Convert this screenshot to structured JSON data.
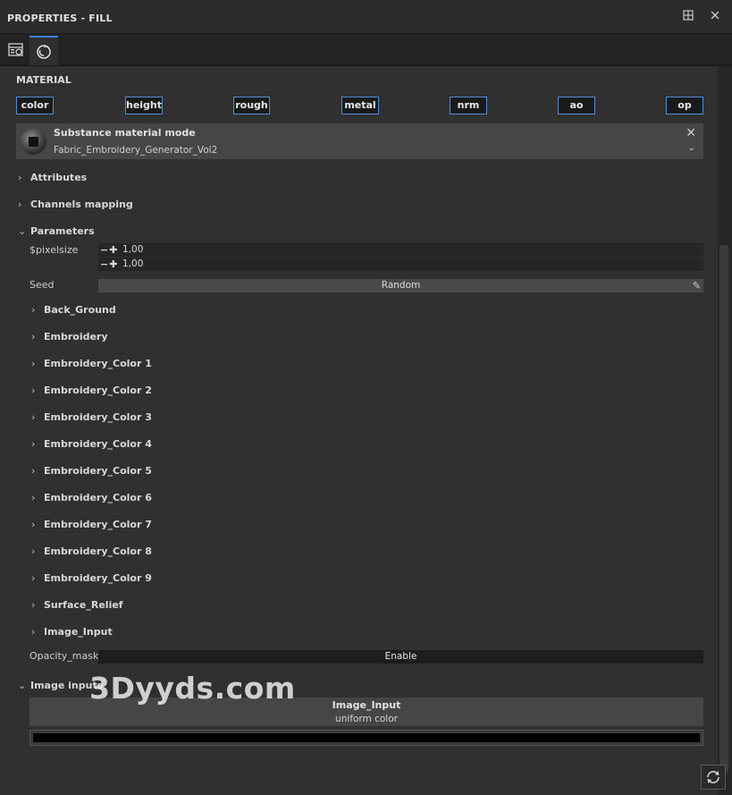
{
  "window": {
    "title": "PROPERTIES - FILL"
  },
  "material": {
    "section_label": "MATERIAL",
    "channels": [
      "color",
      "height",
      "rough",
      "metal",
      "nrm",
      "ao",
      "op"
    ],
    "substance": {
      "title": "Substance material mode",
      "name": "Fabric_Embroidery_Generator_Vol2"
    }
  },
  "sections": {
    "attributes": "Attributes",
    "channels_mapping": "Channels mapping",
    "parameters": "Parameters",
    "image_inputs": "Image inputs"
  },
  "parameters": {
    "pixelsize_label": "$pixelsize",
    "pixelsize_x": "1,00",
    "pixelsize_y": "1,00",
    "seed_label": "Seed",
    "seed_button": "Random",
    "groups": [
      "Back_Ground",
      "Embroidery",
      "Embroidery_Color 1",
      "Embroidery_Color 2",
      "Embroidery_Color 3",
      "Embroidery_Color 4",
      "Embroidery_Color 5",
      "Embroidery_Color 6",
      "Embroidery_Color 7",
      "Embroidery_Color 8",
      "Embroidery_Color 9",
      "Surface_Relief",
      "Image_Input"
    ],
    "opacity_mask_label": "Opacity_mask",
    "opacity_mask_button": "Enable"
  },
  "image_inputs": {
    "card_title": "Image_Input",
    "card_sub": "uniform color",
    "color": "#000000"
  },
  "watermark": "3Dyyds.com",
  "colors": {
    "accent": "#4f8fd8",
    "panel": "#303030"
  }
}
